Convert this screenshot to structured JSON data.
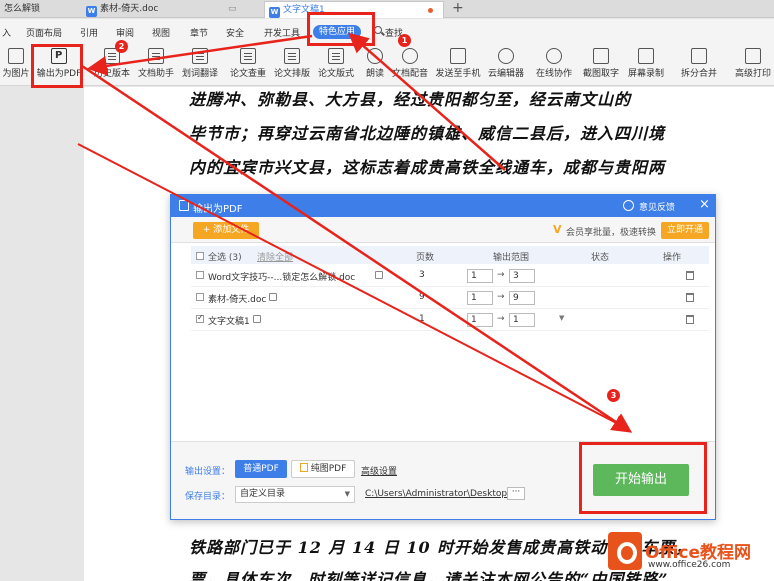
{
  "tabs": [
    {
      "label": "怎么解锁",
      "active": false
    },
    {
      "label": "素材-倚天.doc",
      "active": false
    },
    {
      "label": "文字文稿1",
      "active": true
    }
  ],
  "tab_new": "+",
  "menu": {
    "items": [
      "入",
      "页面布局",
      "引用",
      "审阅",
      "视图",
      "章节",
      "安全",
      "开发工具"
    ],
    "special": "特色应用",
    "search": "查找"
  },
  "toolbar": {
    "items": [
      "为图片",
      "输出为PDF",
      "历史版本",
      "文档助手",
      "划词翻译",
      "论文查重",
      "论文排版",
      "论文版式",
      "朗读",
      "文档配音",
      "发送至手机",
      "云编辑器",
      "在线协作",
      "截图取字",
      "屏幕录制",
      "拆分合并",
      "高级打印"
    ]
  },
  "document": {
    "lines": [
      "进腾冲、弥勒县、大方县，经过贵阳都匀至，经云南文山的",
      "毕节市；再穿过云南省北边陲的镇雄、威信二县后，进入四川境",
      "内的宜宾市兴文县，这标志着成贵高铁全线通车，成都与贵阳两",
      "铁路部门已于 12 月 14 日 10 时开始发售成贵高铁动车组车票，",
      "票，具体车次、时刻等详记信息，请关注本网公告的“中国铁路”"
    ]
  },
  "dialog": {
    "title": "输出为PDF",
    "feedback": "意见反馈",
    "close": "×",
    "add_file": "+ 添加文件",
    "vip_text": "会员享批量，极速转换",
    "vip_button": "立即开通",
    "columns": {
      "select_all": "全选 (3)",
      "clear_all": "清除全部",
      "pages": "页数",
      "range": "输出范围",
      "status": "状态",
      "action": "操作"
    },
    "rows": [
      {
        "name": "Word文字技巧--...锁定怎么解锁.doc",
        "pages": "3",
        "from": "1",
        "to": "3",
        "checked": false
      },
      {
        "name": "素材-倚天.doc",
        "pages": "9",
        "from": "1",
        "to": "9",
        "checked": false
      },
      {
        "name": "文字文稿1",
        "pages": "1",
        "from": "1",
        "to": "1",
        "checked": true
      }
    ],
    "range_arrow": "→",
    "output_settings_label": "输出设置：",
    "normal_pdf": "普通PDF",
    "pure_pdf": "纯图PDF",
    "advanced_settings": "高级设置",
    "save_dir_label": "保存目录：",
    "save_dir_value": "自定义目录",
    "save_path": "C:\\Users\\Administrator\\Desktop\\",
    "more": "···",
    "start_button": "开始输出"
  },
  "annotations": {
    "badges": [
      "1",
      "2",
      "3"
    ],
    "color": "#e8231b"
  },
  "watermark": {
    "brand": "Office教程网",
    "url": "www.office26.com"
  },
  "colors": {
    "accent": "#3d7ee8",
    "orange": "#f5a623",
    "green": "#5db85c",
    "red": "#e8231b"
  }
}
